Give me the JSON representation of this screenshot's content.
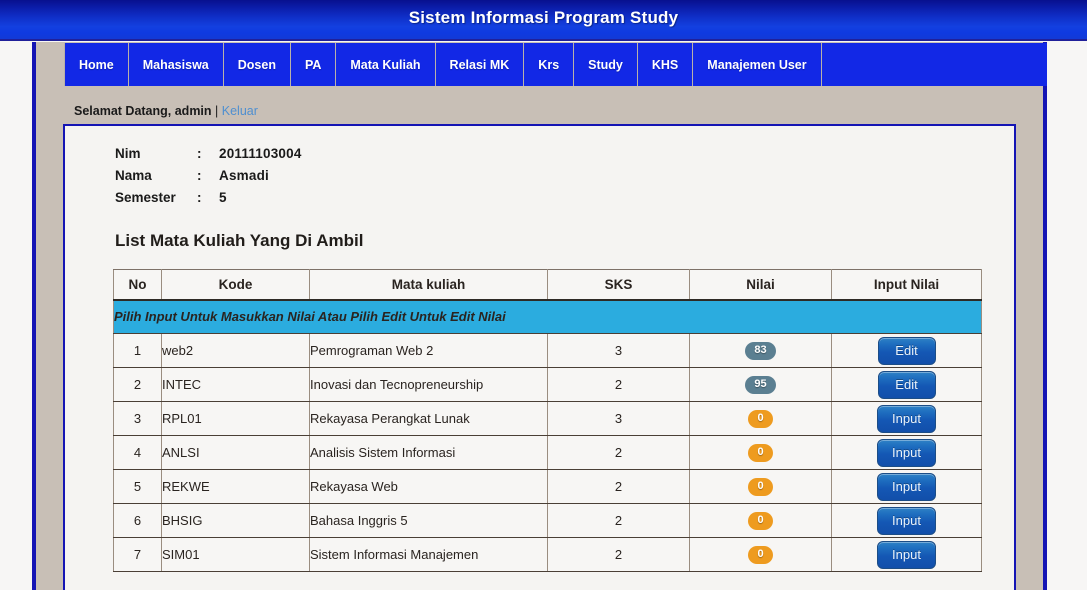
{
  "banner": {
    "title": "Sistem Informasi Program Study"
  },
  "nav": {
    "items": [
      {
        "label": "Home",
        "name": "nav-item-home"
      },
      {
        "label": "Mahasiswa",
        "name": "nav-item-mahasiswa"
      },
      {
        "label": "Dosen",
        "name": "nav-item-dosen"
      },
      {
        "label": "PA",
        "name": "nav-item-pa"
      },
      {
        "label": "Mata Kuliah",
        "name": "nav-item-mata-kuliah"
      },
      {
        "label": "Relasi MK",
        "name": "nav-item-relasi-mk"
      },
      {
        "label": "Krs",
        "name": "nav-item-krs"
      },
      {
        "label": "Study",
        "name": "nav-item-study"
      },
      {
        "label": "KHS",
        "name": "nav-item-khs"
      },
      {
        "label": "Manajemen User",
        "name": "nav-item-manajemen-user"
      }
    ]
  },
  "welcome": {
    "greeting": "Selamat Datang, admin",
    "separator": "|",
    "logout_label": "Keluar"
  },
  "student": {
    "nim_label": "Nim",
    "nim_value": "20111103004",
    "nama_label": "Nama",
    "nama_value": "Asmadi",
    "semester_label": "Semester",
    "semester_value": "5",
    "colon": ":"
  },
  "heading": "List Mata Kuliah Yang Di Ambil",
  "table": {
    "headers": [
      "No",
      "Kode",
      "Mata kuliah",
      "SKS",
      "Nilai",
      "Input Nilai"
    ],
    "notice": "Pilih Input Untuk Masukkan Nilai Atau Pilih Edit Untuk Edit Nilai",
    "rows": [
      {
        "no": "1",
        "kode": "web2",
        "mata_kuliah": "Pemrograman Web 2",
        "sks": "3",
        "nilai": "83",
        "nilai_style": "score",
        "action": "Edit"
      },
      {
        "no": "2",
        "kode": "INTEC",
        "mata_kuliah": "Inovasi dan Tecnopreneurship",
        "sks": "2",
        "nilai": "95",
        "nilai_style": "score",
        "action": "Edit"
      },
      {
        "no": "3",
        "kode": "RPL01",
        "mata_kuliah": "Rekayasa Perangkat Lunak",
        "sks": "3",
        "nilai": "0",
        "nilai_style": "zero",
        "action": "Input"
      },
      {
        "no": "4",
        "kode": "ANLSI",
        "mata_kuliah": "Analisis Sistem Informasi",
        "sks": "2",
        "nilai": "0",
        "nilai_style": "zero",
        "action": "Input"
      },
      {
        "no": "5",
        "kode": "REKWE",
        "mata_kuliah": "Rekayasa Web",
        "sks": "2",
        "nilai": "0",
        "nilai_style": "zero",
        "action": "Input"
      },
      {
        "no": "6",
        "kode": "BHSIG",
        "mata_kuliah": "Bahasa Inggris 5",
        "sks": "2",
        "nilai": "0",
        "nilai_style": "zero",
        "action": "Input"
      },
      {
        "no": "7",
        "kode": "SIM01",
        "mata_kuliah": "Sistem Informasi Manajemen",
        "sks": "2",
        "nilai": "0",
        "nilai_style": "zero",
        "action": "Input"
      }
    ]
  },
  "colors": {
    "banner_blue": "#1228e6",
    "banner_dark": "#08108e",
    "container_tan": "#c8bfb6",
    "border_blue": "#1414b4",
    "notice_cyan": "#2bacdf",
    "badge_score": "#5b7f91",
    "badge_zero": "#ee9b1f",
    "button_blue": "#1457b4",
    "link_blue": "#4f8fd0",
    "panel_bg": "#f5f4f2"
  }
}
